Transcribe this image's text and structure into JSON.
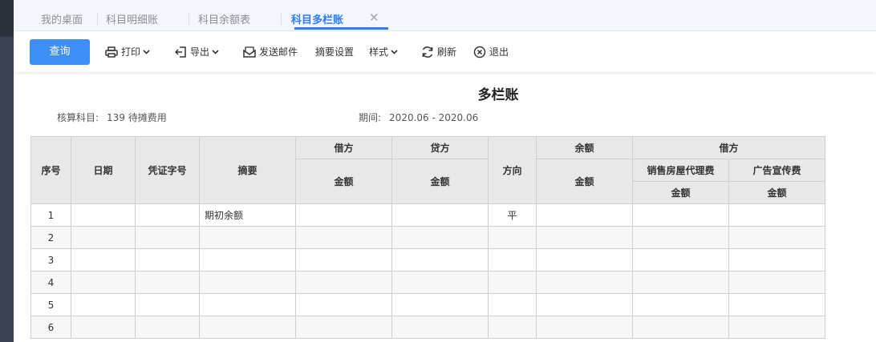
{
  "tabs": [
    {
      "label": "我的桌面"
    },
    {
      "label": "科目明细账"
    },
    {
      "label": "科目余额表"
    },
    {
      "label": "科目多栏账"
    }
  ],
  "toolbar": {
    "query": "查询",
    "print": "打印",
    "export": "导出",
    "email": "发送邮件",
    "summary_settings": "摘要设置",
    "style": "样式",
    "refresh": "刷新",
    "exit": "退出"
  },
  "report": {
    "title": "多栏账",
    "account_label": "核算科目:",
    "account_value": "139 待摊费用",
    "period_label": "期间:",
    "period_value": "2020.06 - 2020.06"
  },
  "table": {
    "h_seq": "序号",
    "h_date": "日期",
    "h_voucher": "凭证字号",
    "h_summary": "摘要",
    "h_debit": "借方",
    "h_credit": "贷方",
    "h_direction": "方向",
    "h_balance": "余额",
    "h_debit_group": "借方",
    "h_amount": "金额",
    "h_sub1": "销售房屋代理费",
    "h_sub2": "广告宣传费",
    "rows": [
      {
        "seq": "1",
        "summary": "期初余额",
        "direction": "平"
      },
      {
        "seq": "2",
        "summary": "",
        "direction": ""
      },
      {
        "seq": "3",
        "summary": "",
        "direction": ""
      },
      {
        "seq": "4",
        "summary": "",
        "direction": ""
      },
      {
        "seq": "5",
        "summary": "",
        "direction": ""
      },
      {
        "seq": "6",
        "summary": "",
        "direction": ""
      }
    ]
  }
}
